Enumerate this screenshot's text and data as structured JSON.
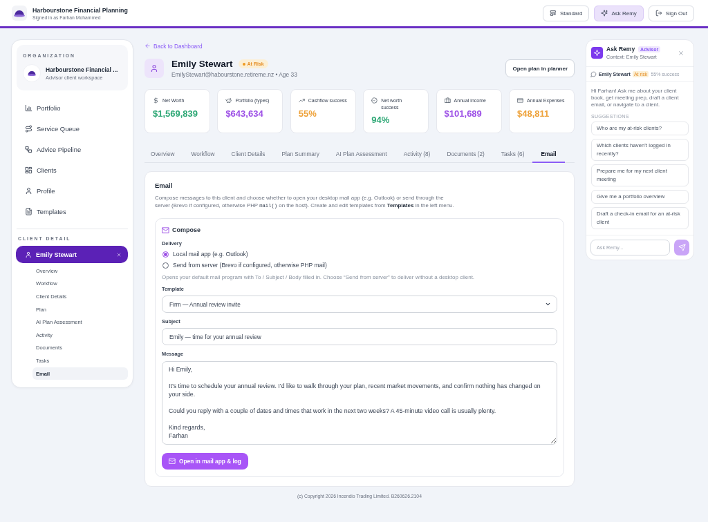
{
  "top_bar": {
    "title": "Harbourstone Financial Planning",
    "subtitle": "Signed in as Farhan Mohammed",
    "buttons": [
      {
        "label": "Standard",
        "selected": false
      },
      {
        "label": "Ask Remy",
        "selected": true
      },
      {
        "label": "Sign Out",
        "selected": false
      }
    ]
  },
  "sidebar": {
    "org_heading": "ORGANIZATION",
    "org_name": "Harbourstone Financial ...",
    "org_subtitle": "Advisor client workspace",
    "nav": [
      {
        "label": "Portfolio",
        "selected": false
      },
      {
        "label": "Service Queue",
        "selected": false
      },
      {
        "label": "Advice Pipeline",
        "selected": false
      },
      {
        "label": "Clients",
        "selected": false
      },
      {
        "label": "Profile",
        "selected": false
      },
      {
        "label": "Templates",
        "selected": false
      }
    ],
    "client_heading": "CLIENT DETAIL",
    "client": {
      "name": "Emily Stewart",
      "selected": true
    },
    "client_nav": [
      {
        "label": "Overview",
        "selected": false
      },
      {
        "label": "Workflow",
        "selected": false
      },
      {
        "label": "Client Details",
        "selected": false
      },
      {
        "label": "Plan",
        "selected": false
      },
      {
        "label": "AI Plan Assessment",
        "selected": false
      },
      {
        "label": "Activity",
        "selected": false
      },
      {
        "label": "Documents",
        "selected": false
      },
      {
        "label": "Tasks",
        "selected": false
      },
      {
        "label": "Email",
        "selected": true
      }
    ]
  },
  "client_header": {
    "back_link": "Back to Dashboard",
    "name": "Emily Stewart",
    "status": "At Risk",
    "contact": "EmilyStewart@habourstone.retireme.nz • Age 33",
    "action": "Open plan in planner"
  },
  "stats": [
    {
      "label": "Net Worth",
      "value": "$1,569,839",
      "color": "#2fa876"
    },
    {
      "label": "Portfolio (types)",
      "value": "$643,634",
      "color": "#9d50e6"
    },
    {
      "label": "Cashflow success",
      "value": "55%",
      "color": "#eea23a"
    },
    {
      "label": "Net worth success",
      "value": "94%",
      "color": "#2fa876"
    },
    {
      "label": "Annual income",
      "value": "$101,689",
      "color": "#9d50e6"
    },
    {
      "label": "Annual Expenses",
      "value": "$48,811",
      "color": "#eea23a"
    }
  ],
  "tabs": [
    {
      "label": "Overview",
      "selected": false
    },
    {
      "label": "Workflow",
      "selected": false
    },
    {
      "label": "Client Details",
      "selected": false
    },
    {
      "label": "Plan Summary",
      "selected": false
    },
    {
      "label": "AI Plan Assessment",
      "selected": false
    },
    {
      "label": "Activity (8)",
      "selected": false
    },
    {
      "label": "Documents (2)",
      "selected": false
    },
    {
      "label": "Tasks (6)",
      "selected": false
    },
    {
      "label": "Email",
      "selected": true
    }
  ],
  "email": {
    "title": "Email",
    "description": [
      {
        "kind": "text",
        "text": "Compose messages to this client and choose whether to open your desktop mail app (e.g. Outlook) or send through the server (Brevo if configured, otherwise PHP "
      },
      {
        "kind": "code",
        "text": "mail()"
      },
      {
        "kind": "text",
        "text": " on the host). Create and edit templates from **Templates** in the left menu."
      }
    ],
    "compose": {
      "title": "Compose",
      "delivery_label": "Delivery",
      "delivery_options": [
        {
          "label": "Local mail app (e.g. Outlook)",
          "selected": true
        },
        {
          "label": "Send from server (Brevo if configured, otherwise PHP mail)",
          "selected": false
        }
      ],
      "hint": "Opens your default mail program with To / Subject / Body filled in. Choose “Send from server” to deliver without a desktop client.",
      "template": {
        "label": "Template",
        "value": "Firm — Annual review invite"
      },
      "subject": {
        "label": "Subject",
        "value": "Emily — time for your annual review"
      },
      "message": {
        "label": "Message",
        "value": "Hi Emily,\n\nIt’s time to schedule your annual review. I’d like to walk through your plan, recent market movements, and confirm nothing has changed on your side.\n\nCould you reply with a couple of dates and times that work in the next two weeks? A 45-minute video call is usually plenty.\n\nKind regards,\nFarhan"
      },
      "submit": "Open in mail app & log"
    }
  },
  "footer": "(c) Copyright 2026 Incendio Trading Limited. B260626.2104",
  "assistant": {
    "title": "Ask Remy",
    "badge": "Advisor",
    "context": "Context: Emily Stewart",
    "client_name": "Emily Stewart",
    "client_status": "At risk",
    "client_success": "55% success",
    "intro": "Hi Farhan! Ask me about your client book, get meeting prep, draft a client email, or navigate to a client.",
    "suggestions_heading": "SUGGESTIONS",
    "suggestions": [
      "Who are my at-risk clients?",
      "Which clients haven't logged in recently?",
      "Prepare me for my next client meeting",
      "Give me a portfolio overview",
      "Draft a check-in email for an at-risk client"
    ],
    "input": {
      "placeholder": "Ask Remy..."
    }
  }
}
